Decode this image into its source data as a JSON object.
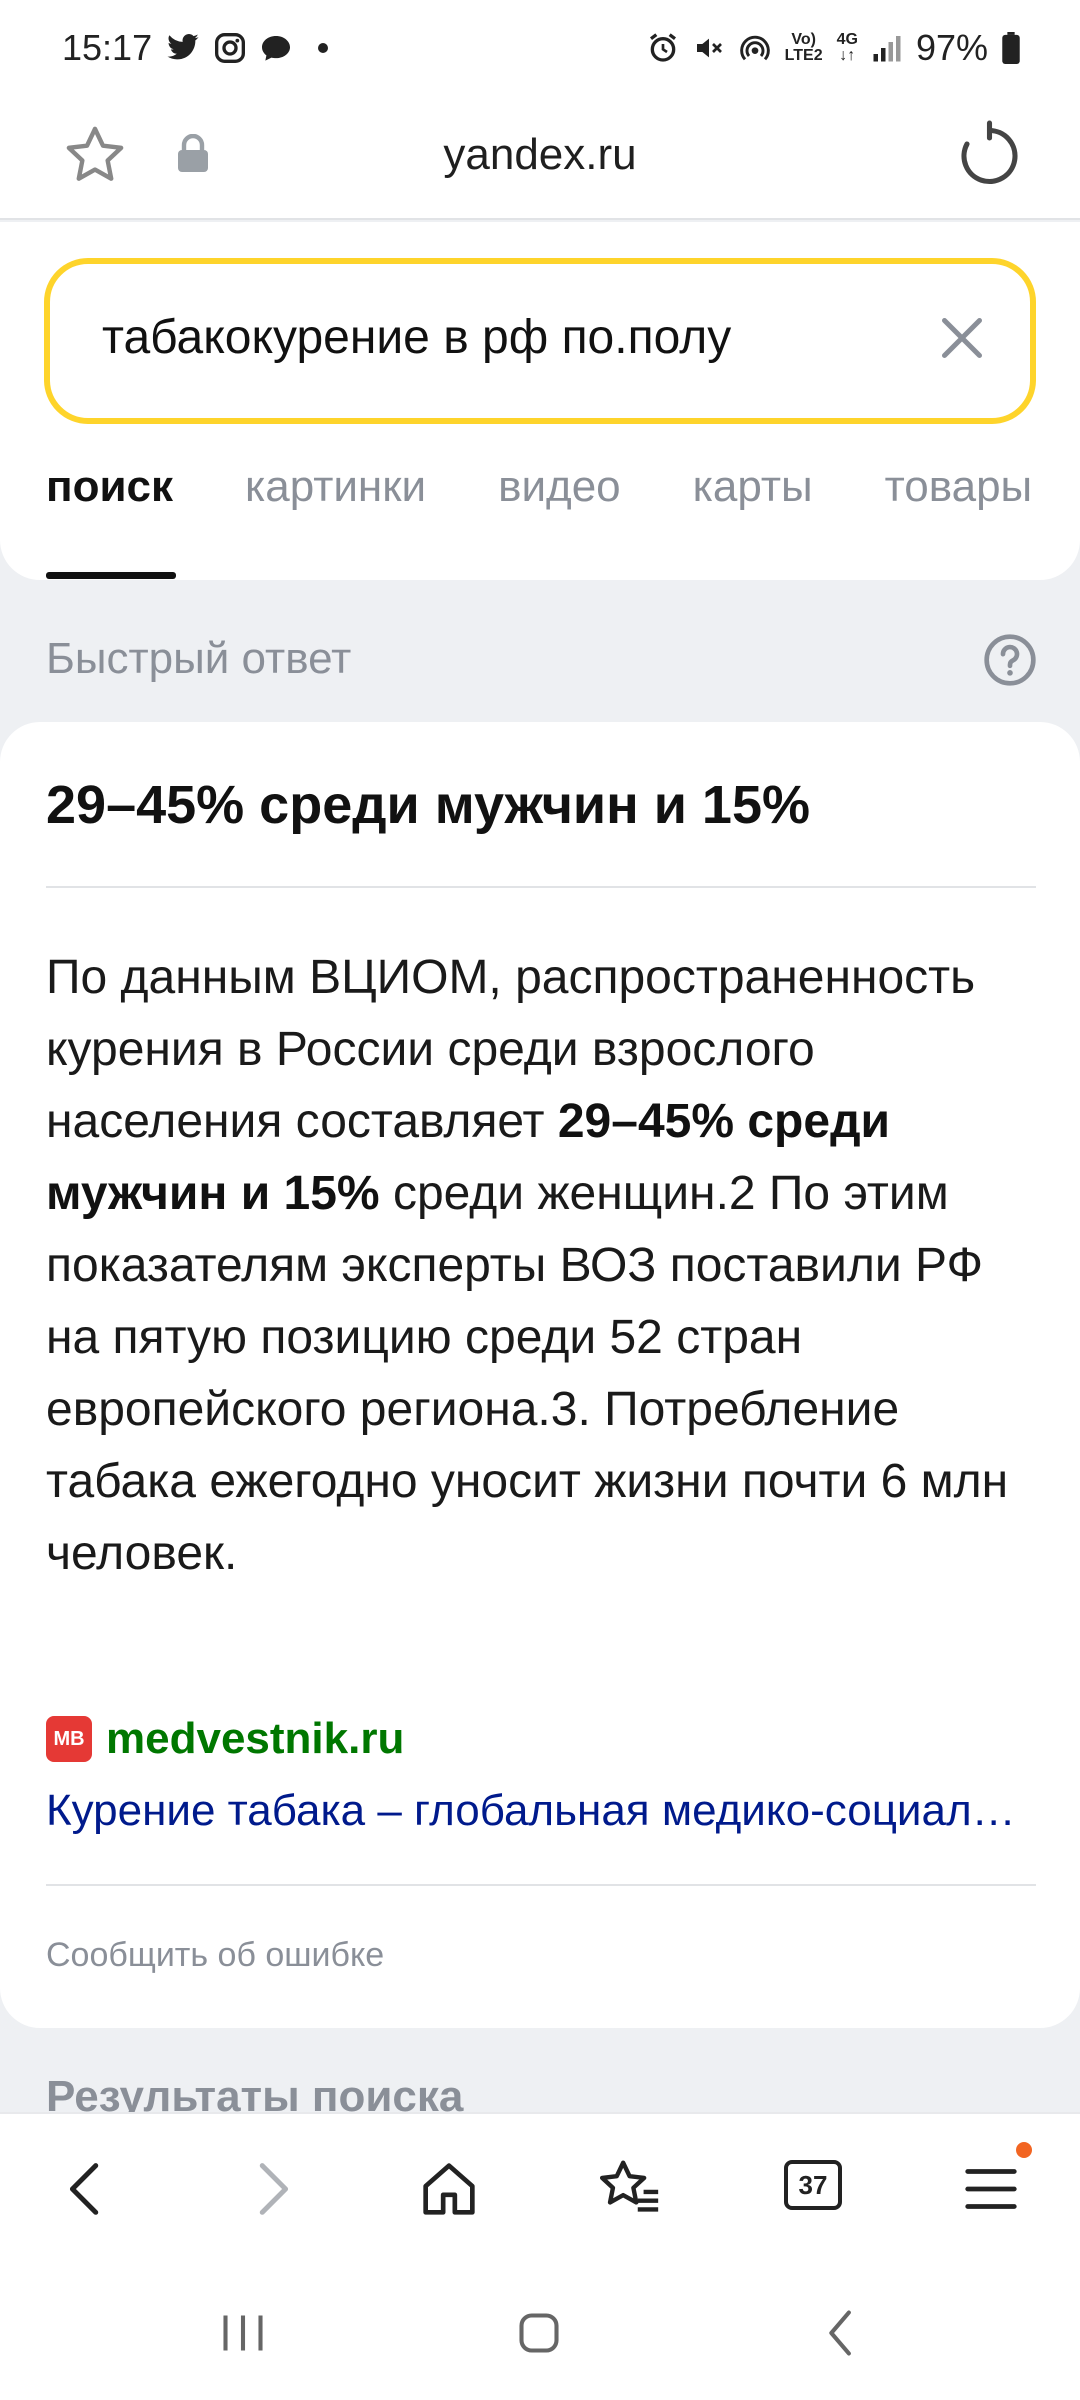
{
  "status_bar": {
    "time": "15:17",
    "net_top": "Vo)",
    "net_bottom": "LTE2",
    "gen_top": "4G",
    "battery": "97%"
  },
  "browser": {
    "domain": "yandex.ru"
  },
  "search": {
    "query": "табакокурение в рф по.полу",
    "tabs": [
      {
        "label": "поиск",
        "active": true
      },
      {
        "label": "картинки",
        "active": false
      },
      {
        "label": "видео",
        "active": false
      },
      {
        "label": "карты",
        "active": false
      },
      {
        "label": "товары",
        "active": false
      }
    ]
  },
  "quick_answer": {
    "section_label": "Быстрый ответ",
    "title": "29–45% среди мужчин и 15%",
    "body_before": "По данным ВЦИОМ, распространенность курения в России среди взрослого населения составляет ",
    "body_bold": "29–45% среди мужчин и 15%",
    "body_after": " среди женщин.2 По этим показателям эксперты ВОЗ поставили РФ на пятую позицию среди 52 стран европейского региона.3. Потребление табака ежегодно уносит жизни почти 6 млн человек.",
    "source_logo": "МВ",
    "source_domain": "medvestnik.ru",
    "source_title": "Курение табака – глобальная медико-социальная проблема",
    "report_error": "Сообщить об ошибке"
  },
  "results_label": "Результаты поиска",
  "toolbar": {
    "tabs_count": "37"
  },
  "colors": {
    "search_border": "#fed42b",
    "source_domain": "#007700",
    "link": "#001a8c",
    "notification": "#f26522"
  }
}
